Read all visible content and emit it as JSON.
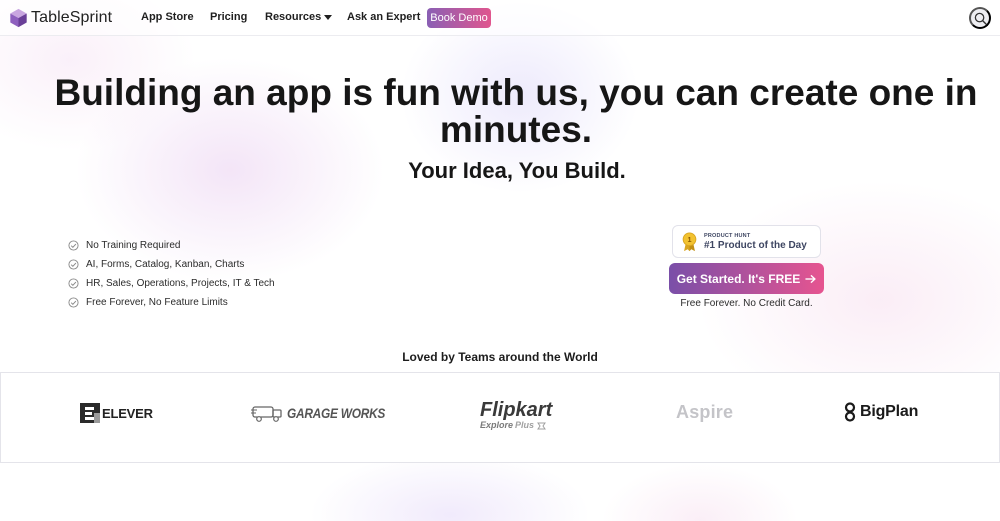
{
  "nav": {
    "brand": "TableSprint",
    "items": [
      {
        "label": "App Store"
      },
      {
        "label": "Pricing"
      },
      {
        "label": "Resources"
      },
      {
        "label": "Ask an Expert"
      }
    ],
    "book_demo": "Book Demo"
  },
  "hero": {
    "headline": "Building an app is fun with us, you can create one in minutes.",
    "subhead": "Your Idea, You Build.",
    "features": [
      "No Training Required",
      "AI, Forms, Catalog, Kanban, Charts",
      "HR, Sales, Operations, Projects, IT & Tech",
      "Free Forever, No Feature Limits"
    ]
  },
  "product_hunt": {
    "small": "PRODUCT HUNT",
    "big": "#1 Product of the Day"
  },
  "cta": {
    "label": "Get Started. It's FREE",
    "note": "Free Forever. No Credit Card."
  },
  "clients": {
    "heading": "Loved by Teams around the World",
    "elever": "ELEVER",
    "garage": "GARAGE WORKS",
    "flipkart": "Flipkart",
    "flipkart_sub": "Explore",
    "flipkart_plus": "Plus",
    "aspire": "Aspire",
    "bigplan": "BigPlan"
  },
  "colors": {
    "accent_start": "#7a4fa8",
    "accent_end": "#e65490",
    "logo_purple": "#7b4fa6"
  },
  "icons": {
    "search": "search-icon",
    "check": "check-circle-icon",
    "arrow": "arrow-right-icon",
    "medal": "medal-icon"
  }
}
